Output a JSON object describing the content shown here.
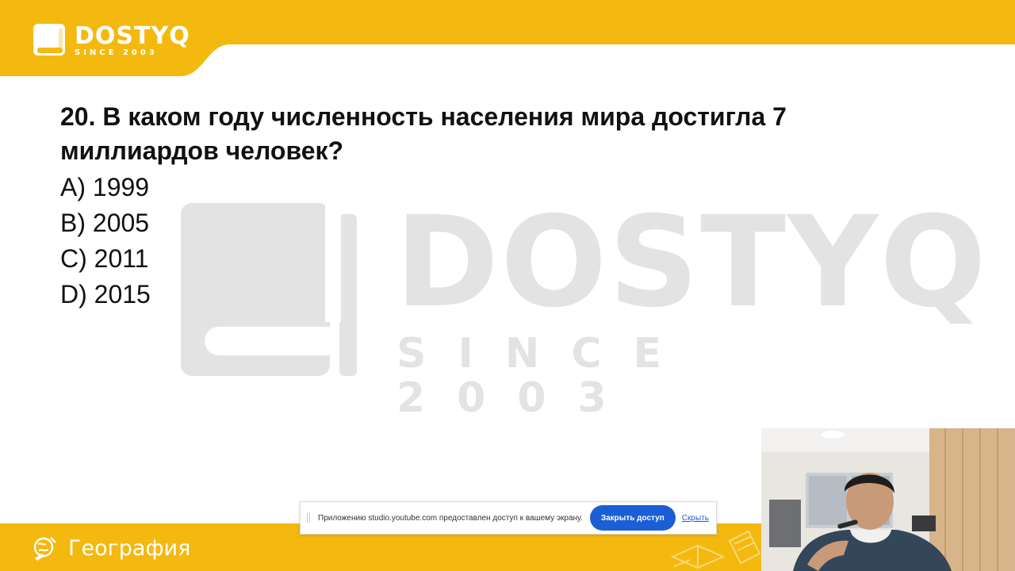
{
  "brand": {
    "name": "DOSTYQ",
    "tagline": "SINCE 2003"
  },
  "watermark": {
    "name": "DOSTYQ",
    "tagline": "SINCE 2003"
  },
  "question": {
    "text": "20. В каком году численность населения мира достигла 7 миллиардов человек?",
    "answers": [
      "A) 1999",
      "B) 2005",
      "C) 2011",
      "D) 2015"
    ]
  },
  "footer": {
    "subject": "География",
    "subject_icon": "globe-pencil-icon"
  },
  "screen_share": {
    "message": "Приложению studio.youtube.com предоставлен доступ к вашему экрану.",
    "stop_label": "Закрыть доступ",
    "hide_label": "Скрыть"
  },
  "colors": {
    "brand_yellow": "#f3b90f",
    "watermark_gray": "#e3e3e3",
    "button_blue": "#1a5fd6"
  }
}
